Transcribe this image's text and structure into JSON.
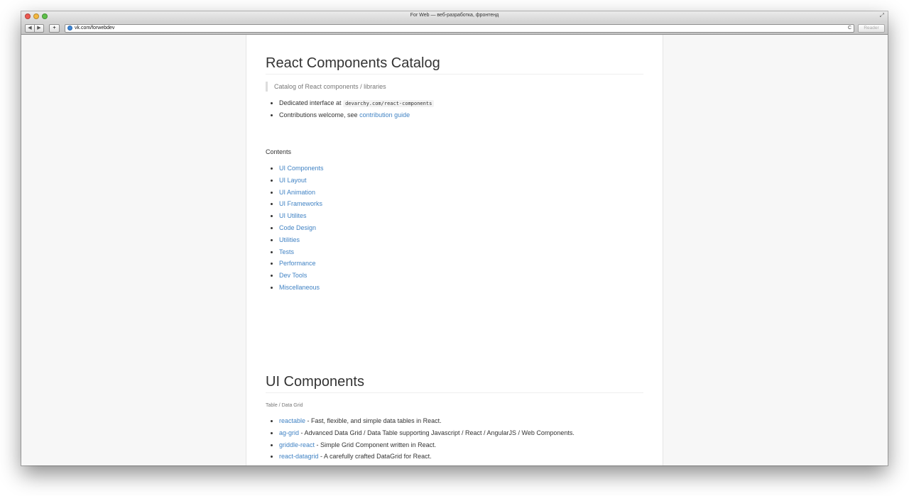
{
  "window": {
    "title": "For Web — веб-разработка, фронтенд"
  },
  "toolbar": {
    "back_label": "◀",
    "forward_label": "▶",
    "add_label": "+",
    "url": "vk.com/forwebdev",
    "reload_label": "C",
    "reader_label": "Reader"
  },
  "article": {
    "title": "React Components Catalog",
    "description": "Catalog of React components / libraries",
    "intro": {
      "item1_text": "Dedicated interface at ",
      "item1_code": "devarchy.com/react-components",
      "item2_text": "Contributions welcome, see ",
      "item2_link": "contribution guide"
    },
    "contents_label": "Contents",
    "contents": [
      "UI Components",
      "UI Layout",
      "UI Animation",
      "UI Frameworks",
      "UI Utilites",
      "Code Design",
      "Utilities",
      "Tests",
      "Performance",
      "Dev Tools",
      "Miscellaneous"
    ],
    "section": {
      "title": "UI Components",
      "subheading": "Table / Data Grid",
      "items": [
        {
          "name": "reactable",
          "desc": " - Fast, flexible, and simple data tables in React."
        },
        {
          "name": "ag-grid",
          "desc": " - Advanced Data Grid / Data Table supporting Javascript / React / AngularJS / Web Components."
        },
        {
          "name": "griddle-react",
          "desc": " - Simple Grid Component written in React."
        },
        {
          "name": "react-datagrid",
          "desc": " - A carefully crafted DataGrid for React."
        }
      ]
    }
  }
}
